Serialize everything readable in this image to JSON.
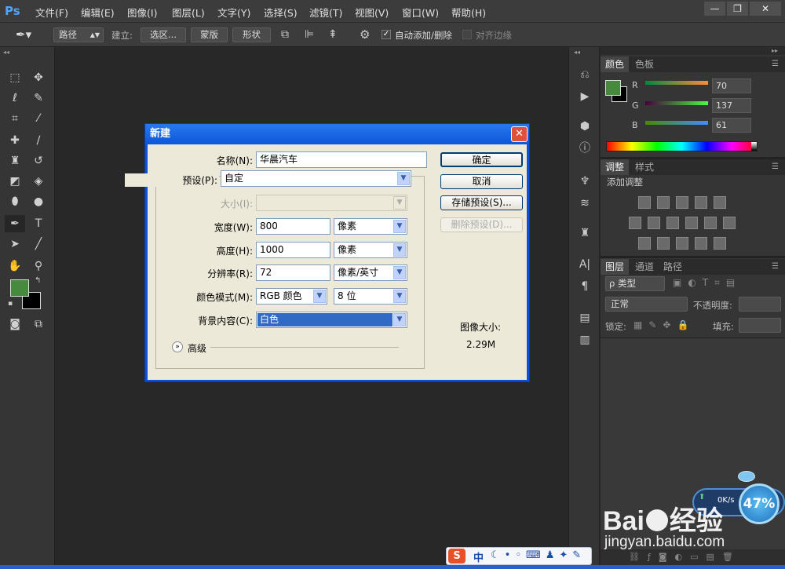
{
  "menubar": {
    "logo": "Ps",
    "items": [
      "文件(F)",
      "编辑(E)",
      "图像(I)",
      "图层(L)",
      "文字(Y)",
      "选择(S)",
      "滤镜(T)",
      "视图(V)",
      "窗口(W)",
      "帮助(H)"
    ],
    "window_buttons": [
      "—",
      "❐",
      "✕"
    ]
  },
  "optionsbar": {
    "mode_select": "路径",
    "create_label": "建立:",
    "selection_btn": "选区...",
    "mask_btn": "蒙版",
    "shape_btn": "形状",
    "auto_add_delete": "自动添加/删除",
    "align_edges": "对齐边缘"
  },
  "colors": {
    "foreground": "#468a3d",
    "background": "#000000",
    "accent_blue": "#4da3ff"
  },
  "color_panel": {
    "tabs": [
      "颜色",
      "色板"
    ],
    "r_label": "R",
    "r_value": "70",
    "g_label": "G",
    "g_value": "137",
    "b_label": "B",
    "b_value": "61"
  },
  "adjust_panel": {
    "tabs": [
      "调整",
      "样式"
    ],
    "title": "添加调整"
  },
  "layers_panel": {
    "tabs": [
      "图层",
      "通道",
      "路径"
    ],
    "kind_select": "ρ 类型",
    "blend_mode": "正常",
    "opacity_label": "不透明度:",
    "lock_label": "锁定:",
    "fill_label": "填充:"
  },
  "dialog": {
    "title": "新建",
    "name_label": "名称(N):",
    "name_value": "华晨汽车",
    "preset_label": "预设(P):",
    "preset_value": "自定",
    "size_label": "大小(I):",
    "width_label": "宽度(W):",
    "width_value": "800",
    "width_unit": "像素",
    "height_label": "高度(H):",
    "height_value": "1000",
    "height_unit": "像素",
    "resolution_label": "分辨率(R):",
    "resolution_value": "72",
    "resolution_unit": "像素/英寸",
    "colormode_label": "颜色模式(M):",
    "colormode_value": "RGB 颜色",
    "bitdepth_value": "8 位",
    "bgcontent_label": "背景内容(C):",
    "bgcontent_value": "白色",
    "advanced_label": "高级",
    "ok_btn": "确定",
    "cancel_btn": "取消",
    "save_preset_btn": "存储预设(S)...",
    "delete_preset_btn": "删除预设(D)...",
    "image_size_label": "图像大小:",
    "image_size_value": "2.29M"
  },
  "overlay": {
    "speed": "0K/s",
    "percent": "47%",
    "watermark_brand": "Bai",
    "watermark_cn": "经验",
    "watermark_url": "jingyan.baidu.com",
    "ime_label": "中"
  }
}
